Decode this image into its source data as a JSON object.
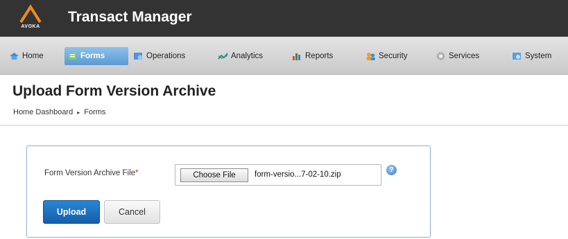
{
  "header": {
    "logo_text": "AVOKA",
    "app_title": "Transact Manager"
  },
  "nav": {
    "items": [
      {
        "label": "Home",
        "icon": "home-icon"
      },
      {
        "label": "Forms",
        "icon": "forms-icon",
        "active": true
      },
      {
        "label": "Operations",
        "icon": "operations-icon"
      },
      {
        "label": "Analytics",
        "icon": "analytics-icon"
      },
      {
        "label": "Reports",
        "icon": "reports-icon"
      },
      {
        "label": "Security",
        "icon": "security-icon"
      },
      {
        "label": "Services",
        "icon": "services-icon"
      },
      {
        "label": "System",
        "icon": "system-icon"
      }
    ]
  },
  "page": {
    "title": "Upload Form Version Archive",
    "breadcrumb": [
      "Home Dashboard",
      "Forms"
    ],
    "breadcrumb_separator": "▸"
  },
  "form": {
    "field_label": "Form Version Archive File",
    "required_marker": "*",
    "choose_file_label": "Choose File",
    "file_name": "form-versio...7-02-10.zip",
    "help_icon": "?",
    "upload_label": "Upload",
    "cancel_label": "Cancel"
  },
  "colors": {
    "header_bg": "#333333",
    "accent": "#1a6fbf",
    "logo_orange": "#f08a1d"
  }
}
